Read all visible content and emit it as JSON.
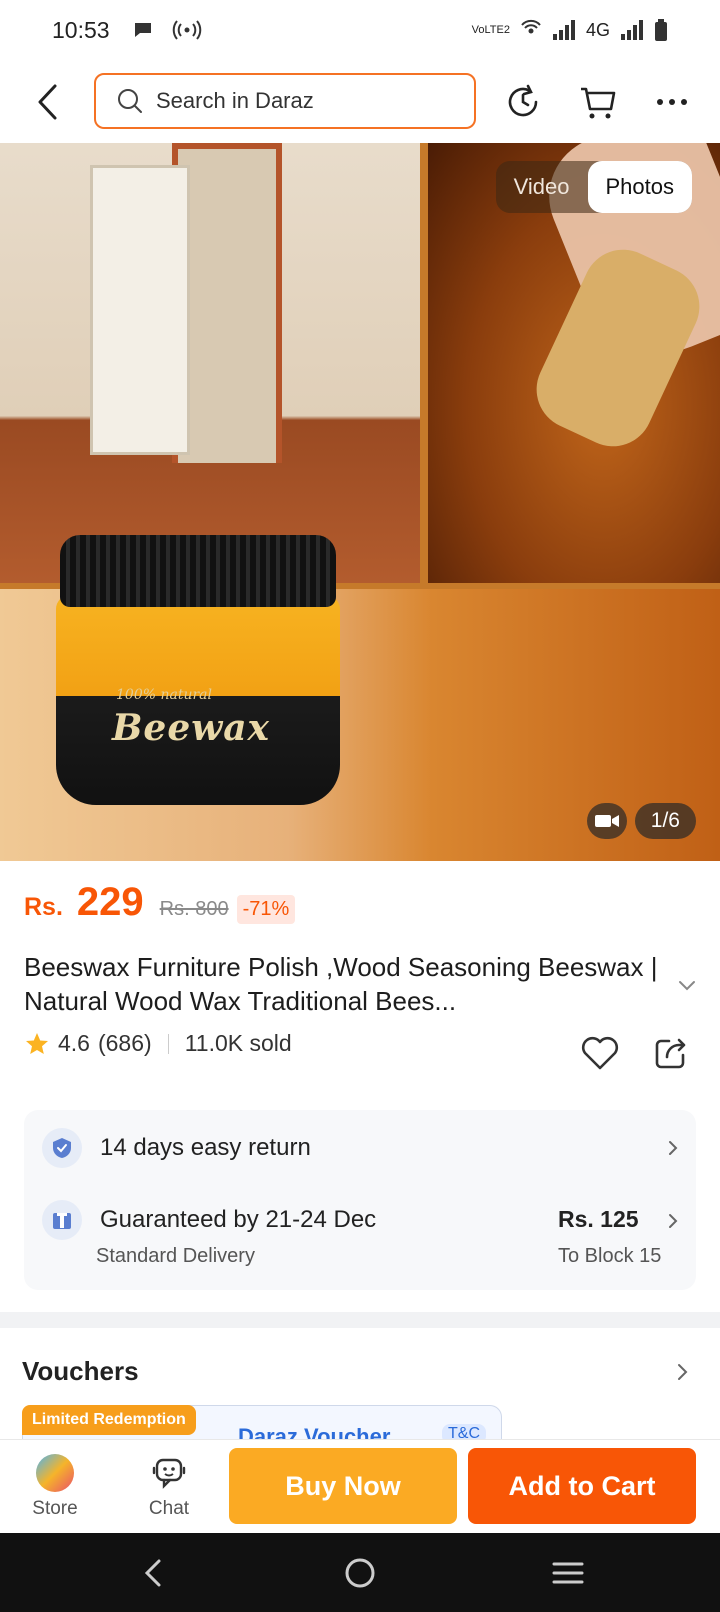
{
  "status_bar": {
    "time": "10:53",
    "network_label": "4G",
    "volte_label": "VoLTE2"
  },
  "header": {
    "search_placeholder": "Search in Daraz"
  },
  "gallery": {
    "tabs": [
      {
        "label": "Video",
        "active": false
      },
      {
        "label": "Photos",
        "active": true
      }
    ],
    "counter": "1/6",
    "jar_subtitle": "100% natural",
    "jar_title": "Beewax"
  },
  "product": {
    "currency": "Rs.",
    "price": "229",
    "original_price": "Rs. 800",
    "discount": "-71%",
    "title": "Beeswax Furniture Polish ,Wood Seasoning Beeswax | Natural Wood Wax Traditional Bees...",
    "rating": "4.6",
    "review_count": "(686)",
    "sold": "11.0K sold"
  },
  "services": {
    "return_label": "14 days easy return",
    "delivery_label": "Guaranteed by 21-24 Dec",
    "delivery_type": "Standard Delivery",
    "delivery_price": "Rs. 125",
    "delivery_location": "To Block 15"
  },
  "vouchers": {
    "title": "Vouchers",
    "badge": "Limited Redemption",
    "voucher_name": "Daraz Voucher",
    "tc_label": "T&C"
  },
  "bottom_bar": {
    "store_label": "Store",
    "chat_label": "Chat",
    "buy_now_label": "Buy Now",
    "add_to_cart_label": "Add to Cart"
  },
  "colors": {
    "accent_orange": "#f85606",
    "buy_now_yellow": "#fbaa23",
    "search_border": "#f57224",
    "voucher_blue": "#2b6bd9"
  },
  "icons": [
    "back-icon",
    "search-icon",
    "refresh-icon",
    "cart-icon",
    "more-icon",
    "video-icon",
    "chevron-down-icon",
    "star-icon",
    "heart-icon",
    "share-icon",
    "shield-check-icon",
    "delivery-icon",
    "chevron-right-icon",
    "store-icon",
    "chat-icon",
    "nav-back-icon",
    "nav-home-icon",
    "nav-menu-icon"
  ]
}
